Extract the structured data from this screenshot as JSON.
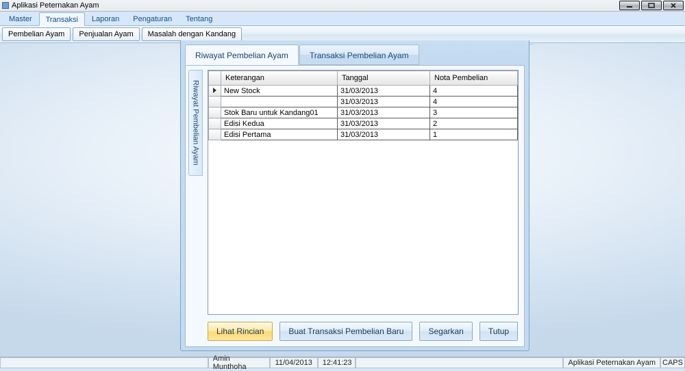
{
  "window": {
    "title": "Aplikasi Peternakan Ayam"
  },
  "menu": {
    "items": [
      "Master",
      "Transaksi",
      "Laporan",
      "Pengaturan",
      "Tentang"
    ],
    "activeIndex": 1
  },
  "toolbar": {
    "buttons": [
      "Pembelian Ayam",
      "Penjualan Ayam",
      "Masalah dengan Kandang"
    ]
  },
  "panel": {
    "tabs": [
      {
        "label": "Riwayat Pembelian Ayam",
        "active": true
      },
      {
        "label": "Transaksi Pembelian Ayam",
        "active": false
      }
    ],
    "sideTab": "Riwayat Pembelian Ayam",
    "grid": {
      "columns": [
        "Keterangan",
        "Tanggal",
        "Nota Pembelian"
      ],
      "rows": [
        {
          "selected": true,
          "keterangan": "New Stock",
          "tanggal": "31/03/2013",
          "nota": "4"
        },
        {
          "selected": false,
          "keterangan": "",
          "tanggal": "31/03/2013",
          "nota": "4"
        },
        {
          "selected": false,
          "keterangan": "Stok Baru untuk Kandang01",
          "tanggal": "31/03/2013",
          "nota": "3"
        },
        {
          "selected": false,
          "keterangan": "Edisi Kedua",
          "tanggal": "31/03/2013",
          "nota": "2"
        },
        {
          "selected": false,
          "keterangan": "Edisi Pertama",
          "tanggal": "31/03/2013",
          "nota": "1"
        }
      ]
    },
    "buttons": {
      "lihat": "Lihat Rincian",
      "buat": "Buat Transaksi Pembelian Baru",
      "segarkan": "Segarkan",
      "tutup": "Tutup"
    }
  },
  "status": {
    "user": "Amin Munthoha",
    "date": "11/04/2013",
    "time": "12:41:23",
    "appname": "Aplikasi Peternakan Ayam",
    "caps": "CAPS"
  }
}
